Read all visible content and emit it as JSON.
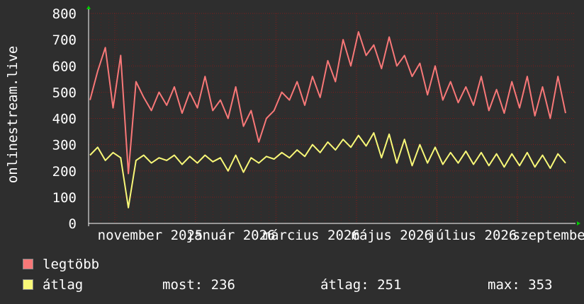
{
  "colors": {
    "legtobb": "#f87878",
    "atlag": "#f8f878",
    "grid": "#7a2020",
    "axis": "#ffffff",
    "arrow": "#00cc00"
  },
  "chart_data": {
    "type": "line",
    "ylabel": "onlinestream.live",
    "ylim": [
      0,
      800
    ],
    "y_ticks": [
      "0",
      "100",
      "200",
      "300",
      "400",
      "500",
      "600",
      "700",
      "800"
    ],
    "x_ticks": [
      "november 2025",
      "január 2026",
      "március 2026",
      "május 2026",
      "július 2026",
      "szeptember"
    ],
    "grid": true,
    "legend_position": "bottom",
    "series": [
      {
        "name": "legtöbb",
        "key": "max",
        "summary_values": [
          470,
          580,
          670,
          440,
          640,
          190,
          540,
          480,
          430,
          500,
          450,
          520,
          420,
          500,
          440,
          560,
          430,
          470,
          400,
          520,
          370,
          430,
          310,
          400,
          430,
          500,
          470,
          540,
          450,
          560,
          480,
          620,
          540,
          700,
          600,
          730,
          640,
          680,
          590,
          710,
          600,
          640,
          560,
          610,
          490,
          600,
          470,
          540,
          460,
          520,
          450,
          560,
          430,
          510,
          420,
          540,
          440,
          560,
          410,
          520,
          400,
          560,
          420
        ]
      },
      {
        "name": "átlag",
        "key": "avg",
        "summary_values": [
          260,
          290,
          240,
          270,
          250,
          60,
          240,
          260,
          230,
          250,
          240,
          260,
          225,
          255,
          230,
          260,
          235,
          250,
          200,
          260,
          195,
          250,
          230,
          255,
          245,
          270,
          250,
          280,
          255,
          300,
          270,
          310,
          280,
          320,
          290,
          335,
          295,
          345,
          250,
          340,
          230,
          320,
          220,
          300,
          230,
          290,
          225,
          270,
          230,
          275,
          225,
          270,
          220,
          265,
          215,
          265,
          220,
          270,
          215,
          260,
          210,
          265,
          230
        ]
      }
    ]
  },
  "legend": {
    "max_label": "legtöbb",
    "avg_label": "átlag"
  },
  "stats": {
    "most": "most: 236",
    "atlag": "átlag: 251",
    "max": "max: 353"
  }
}
